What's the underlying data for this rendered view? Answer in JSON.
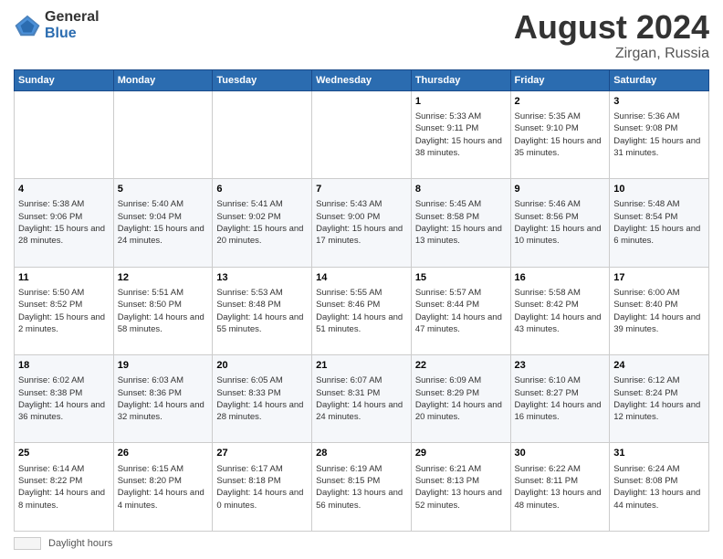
{
  "header": {
    "logo_general": "General",
    "logo_blue": "Blue",
    "month_year": "August 2024",
    "location": "Zirgan, Russia"
  },
  "weekdays": [
    "Sunday",
    "Monday",
    "Tuesday",
    "Wednesday",
    "Thursday",
    "Friday",
    "Saturday"
  ],
  "footer": {
    "daylight_label": "Daylight hours"
  },
  "weeks": [
    [
      {
        "day": "",
        "info": ""
      },
      {
        "day": "",
        "info": ""
      },
      {
        "day": "",
        "info": ""
      },
      {
        "day": "",
        "info": ""
      },
      {
        "day": "1",
        "info": "Sunrise: 5:33 AM\nSunset: 9:11 PM\nDaylight: 15 hours\nand 38 minutes."
      },
      {
        "day": "2",
        "info": "Sunrise: 5:35 AM\nSunset: 9:10 PM\nDaylight: 15 hours\nand 35 minutes."
      },
      {
        "day": "3",
        "info": "Sunrise: 5:36 AM\nSunset: 9:08 PM\nDaylight: 15 hours\nand 31 minutes."
      }
    ],
    [
      {
        "day": "4",
        "info": "Sunrise: 5:38 AM\nSunset: 9:06 PM\nDaylight: 15 hours\nand 28 minutes."
      },
      {
        "day": "5",
        "info": "Sunrise: 5:40 AM\nSunset: 9:04 PM\nDaylight: 15 hours\nand 24 minutes."
      },
      {
        "day": "6",
        "info": "Sunrise: 5:41 AM\nSunset: 9:02 PM\nDaylight: 15 hours\nand 20 minutes."
      },
      {
        "day": "7",
        "info": "Sunrise: 5:43 AM\nSunset: 9:00 PM\nDaylight: 15 hours\nand 17 minutes."
      },
      {
        "day": "8",
        "info": "Sunrise: 5:45 AM\nSunset: 8:58 PM\nDaylight: 15 hours\nand 13 minutes."
      },
      {
        "day": "9",
        "info": "Sunrise: 5:46 AM\nSunset: 8:56 PM\nDaylight: 15 hours\nand 10 minutes."
      },
      {
        "day": "10",
        "info": "Sunrise: 5:48 AM\nSunset: 8:54 PM\nDaylight: 15 hours\nand 6 minutes."
      }
    ],
    [
      {
        "day": "11",
        "info": "Sunrise: 5:50 AM\nSunset: 8:52 PM\nDaylight: 15 hours\nand 2 minutes."
      },
      {
        "day": "12",
        "info": "Sunrise: 5:51 AM\nSunset: 8:50 PM\nDaylight: 14 hours\nand 58 minutes."
      },
      {
        "day": "13",
        "info": "Sunrise: 5:53 AM\nSunset: 8:48 PM\nDaylight: 14 hours\nand 55 minutes."
      },
      {
        "day": "14",
        "info": "Sunrise: 5:55 AM\nSunset: 8:46 PM\nDaylight: 14 hours\nand 51 minutes."
      },
      {
        "day": "15",
        "info": "Sunrise: 5:57 AM\nSunset: 8:44 PM\nDaylight: 14 hours\nand 47 minutes."
      },
      {
        "day": "16",
        "info": "Sunrise: 5:58 AM\nSunset: 8:42 PM\nDaylight: 14 hours\nand 43 minutes."
      },
      {
        "day": "17",
        "info": "Sunrise: 6:00 AM\nSunset: 8:40 PM\nDaylight: 14 hours\nand 39 minutes."
      }
    ],
    [
      {
        "day": "18",
        "info": "Sunrise: 6:02 AM\nSunset: 8:38 PM\nDaylight: 14 hours\nand 36 minutes."
      },
      {
        "day": "19",
        "info": "Sunrise: 6:03 AM\nSunset: 8:36 PM\nDaylight: 14 hours\nand 32 minutes."
      },
      {
        "day": "20",
        "info": "Sunrise: 6:05 AM\nSunset: 8:33 PM\nDaylight: 14 hours\nand 28 minutes."
      },
      {
        "day": "21",
        "info": "Sunrise: 6:07 AM\nSunset: 8:31 PM\nDaylight: 14 hours\nand 24 minutes."
      },
      {
        "day": "22",
        "info": "Sunrise: 6:09 AM\nSunset: 8:29 PM\nDaylight: 14 hours\nand 20 minutes."
      },
      {
        "day": "23",
        "info": "Sunrise: 6:10 AM\nSunset: 8:27 PM\nDaylight: 14 hours\nand 16 minutes."
      },
      {
        "day": "24",
        "info": "Sunrise: 6:12 AM\nSunset: 8:24 PM\nDaylight: 14 hours\nand 12 minutes."
      }
    ],
    [
      {
        "day": "25",
        "info": "Sunrise: 6:14 AM\nSunset: 8:22 PM\nDaylight: 14 hours\nand 8 minutes."
      },
      {
        "day": "26",
        "info": "Sunrise: 6:15 AM\nSunset: 8:20 PM\nDaylight: 14 hours\nand 4 minutes."
      },
      {
        "day": "27",
        "info": "Sunrise: 6:17 AM\nSunset: 8:18 PM\nDaylight: 14 hours\nand 0 minutes."
      },
      {
        "day": "28",
        "info": "Sunrise: 6:19 AM\nSunset: 8:15 PM\nDaylight: 13 hours\nand 56 minutes."
      },
      {
        "day": "29",
        "info": "Sunrise: 6:21 AM\nSunset: 8:13 PM\nDaylight: 13 hours\nand 52 minutes."
      },
      {
        "day": "30",
        "info": "Sunrise: 6:22 AM\nSunset: 8:11 PM\nDaylight: 13 hours\nand 48 minutes."
      },
      {
        "day": "31",
        "info": "Sunrise: 6:24 AM\nSunset: 8:08 PM\nDaylight: 13 hours\nand 44 minutes."
      }
    ]
  ]
}
